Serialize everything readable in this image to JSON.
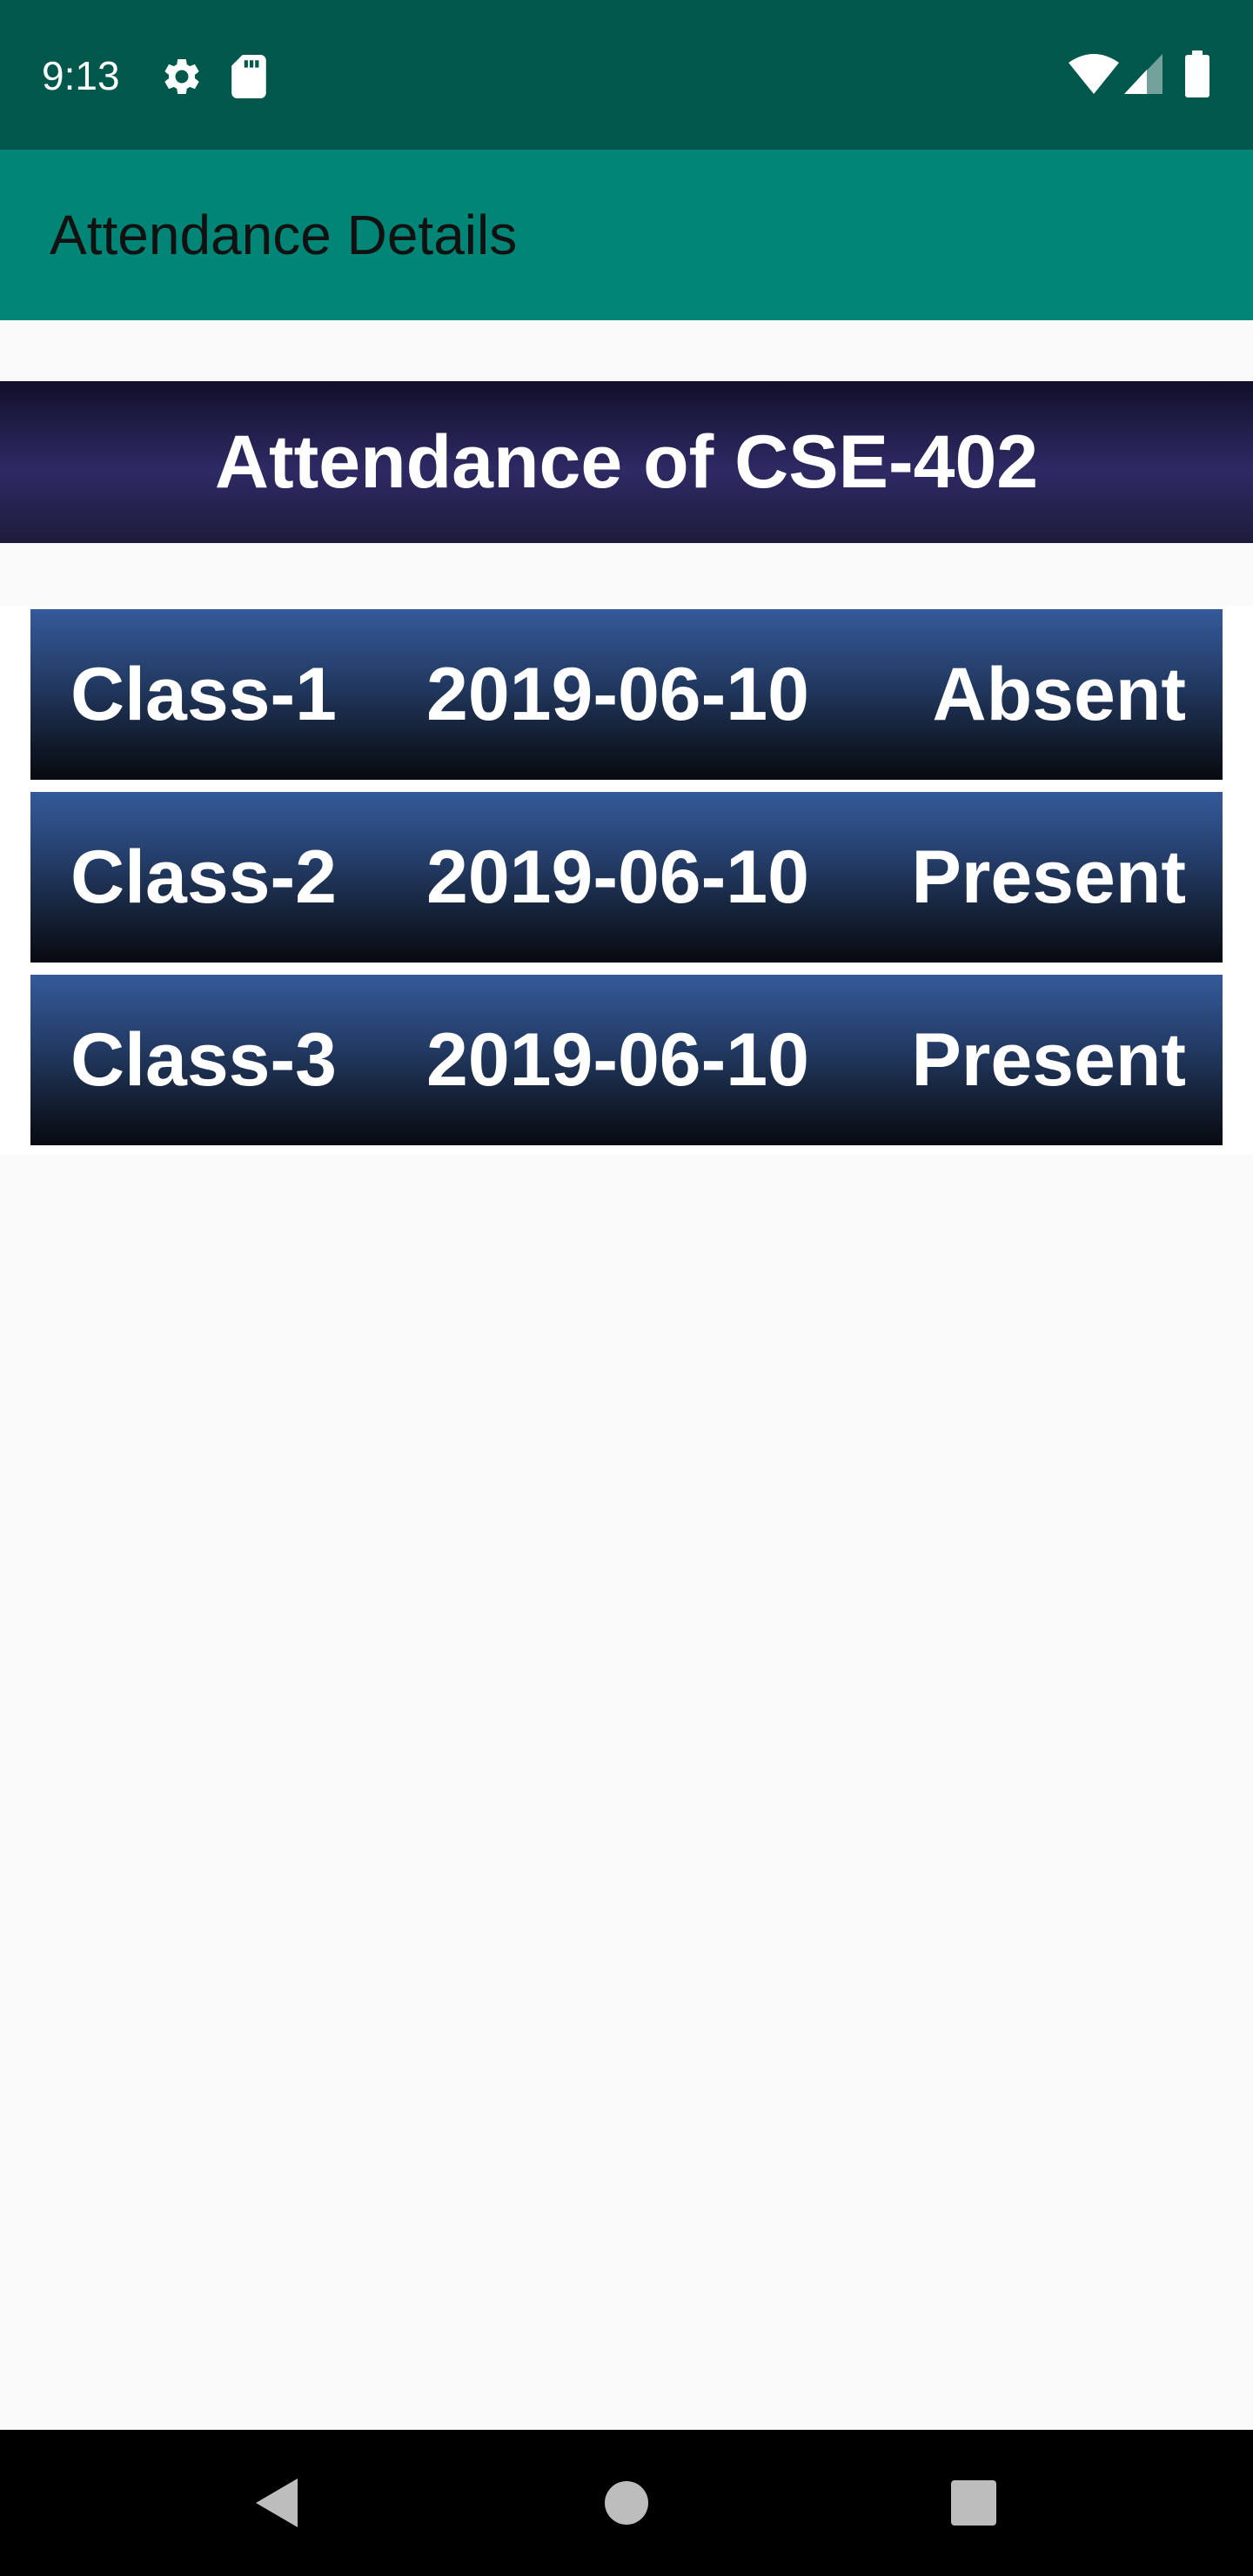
{
  "status_bar": {
    "time": "9:13",
    "icons": [
      "gear-icon",
      "sd-card-icon",
      "wifi-icon",
      "cell-signal-icon",
      "battery-icon"
    ]
  },
  "app_bar": {
    "title": "Attendance Details"
  },
  "header": {
    "title": "Attendance of CSE-402"
  },
  "attendance_list": [
    {
      "class_name": "Class-1",
      "date": "2019-06-10",
      "status": "Absent"
    },
    {
      "class_name": "Class-2",
      "date": "2019-06-10",
      "status": "Present"
    },
    {
      "class_name": "Class-3",
      "date": "2019-06-10",
      "status": "Present"
    }
  ],
  "nav_bar": {
    "icons": [
      "back-icon",
      "home-icon",
      "recents-icon"
    ]
  },
  "colors": {
    "status_bar": "#00574b",
    "app_bar": "#008577",
    "header_banner": "#2e2a64",
    "row_top": "#355a9a",
    "row_bottom": "#080a10",
    "background": "#fafafa"
  }
}
